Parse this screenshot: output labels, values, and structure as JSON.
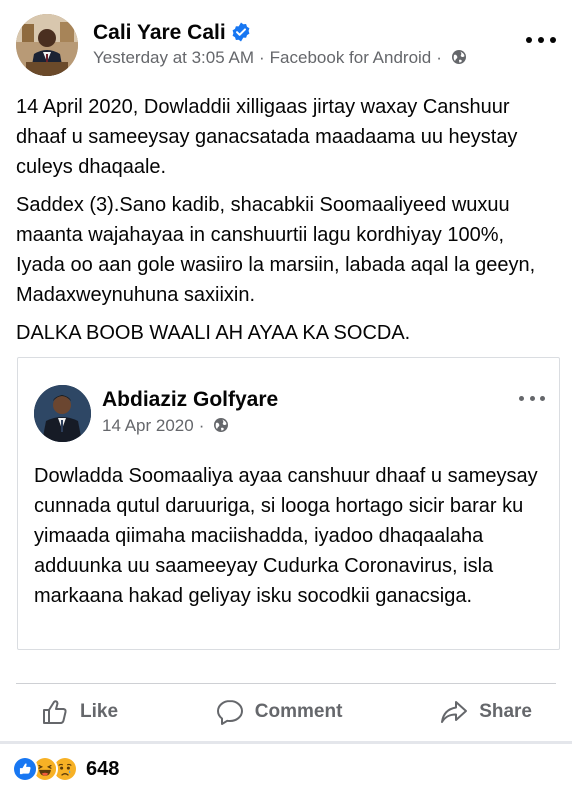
{
  "post": {
    "author": "Cali Yare Cali",
    "time": "Yesterday at 3:05 AM",
    "source": "Facebook for Android",
    "paragraphs": [
      "14 April 2020, Dowladdii xilligaas jirtay waxay Canshuur dhaaf u sameeysay ganacsatada maadaama uu heystay culeys dhaqaale.",
      "Saddex (3).Sano kadib, shacabkii Soomaaliyeed wuxuu maanta wajahayaa in canshuurtii lagu kordhiyay 100%, Iyada oo aan gole wasiiro la marsiin, labada aqal la geeyn, Madaxweynuhuna saxiixin.",
      "DALKA BOOB WAALI AH AYAA KA SOCDA."
    ]
  },
  "shared": {
    "author": "Abdiaziz Golfyare",
    "date": "14 Apr 2020",
    "text": "Dowladda Soomaaliya ayaa canshuur dhaaf u sameysay cunnada qutul daruuriga, si looga hortago sicir barar ku yimaada qiimaha maciishadda, iyadoo dhaqaalaha adduunka uu saameeyay Cudurka Coronavirus, isla markaana hakad geliyay isku socodkii ganacsiga."
  },
  "actions": {
    "like": "Like",
    "comment": "Comment",
    "share": "Share"
  },
  "reactions": {
    "types": [
      "like-icon",
      "haha-icon",
      "sad-icon"
    ],
    "count": "648"
  },
  "colors": {
    "verified": "#1877f2",
    "meta_text": "#65676b",
    "like_blue": "#1877f2",
    "emoji_yellow": "#f7b125"
  }
}
